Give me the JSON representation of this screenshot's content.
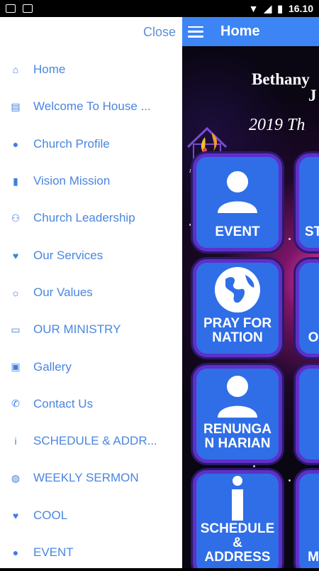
{
  "status_bar": {
    "time": "16.10"
  },
  "drawer": {
    "close_label": "Close",
    "items": [
      {
        "label": "Home",
        "icon": "home-icon"
      },
      {
        "label": "Welcome To House ...",
        "icon": "document-icon"
      },
      {
        "label": "Church Profile",
        "icon": "person-icon"
      },
      {
        "label": "Vision Mission",
        "icon": "bookmark-icon"
      },
      {
        "label": "Church Leadership",
        "icon": "group-icon"
      },
      {
        "label": "Our Services",
        "icon": "heart-icon"
      },
      {
        "label": "Our Values",
        "icon": "lightbulb-icon"
      },
      {
        "label": "OUR MINISTRY",
        "icon": "tablet-icon"
      },
      {
        "label": "Gallery",
        "icon": "image-icon"
      },
      {
        "label": "Contact Us",
        "icon": "phone-icon"
      },
      {
        "label": "SCHEDULE & ADDR...",
        "icon": "info-icon"
      },
      {
        "label": "WEEKLY SERMON",
        "icon": "globe-icon"
      },
      {
        "label": "COOL",
        "icon": "heart-icon"
      },
      {
        "label": "EVENT",
        "icon": "person-icon"
      }
    ]
  },
  "app_bar": {
    "title": "Home"
  },
  "header": {
    "line1": "Bethany",
    "line2": "J",
    "line3": "2019 Th",
    "logo_caption": "House of Worship"
  },
  "tiles": [
    {
      "label": "EVENT",
      "icon": "person-icon"
    },
    {
      "label": "PRAY FOR NATION",
      "icon": "globe-icon"
    },
    {
      "label": "RENUNGA N HARIAN",
      "icon": "person-icon"
    },
    {
      "label": "SCHEDULE & ADDRESS",
      "icon": "info-icon"
    }
  ],
  "partial_tiles": [
    {
      "label": "ST"
    },
    {
      "label": "O"
    },
    {
      "label": ""
    },
    {
      "label": "M"
    }
  ],
  "colors": {
    "accent": "#3d85f5",
    "drawer_text": "#4a86e0",
    "tile": "#2f6ee6",
    "tile_border": "#5f2fc9"
  }
}
